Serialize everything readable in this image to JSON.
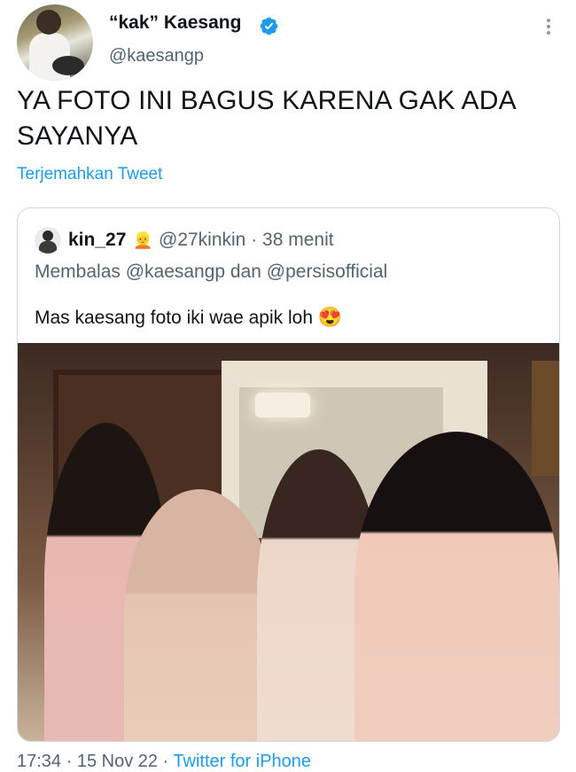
{
  "tweet": {
    "author_name": "“kak” Kaesang",
    "author_handle": "@kaesangp",
    "text": "YA FOTO INI BAGUS KARENA GAK ADA SAYANYA",
    "translate_label": "Terjemahkan Tweet",
    "timestamp": "17:34 · 15 Nov 22 · ",
    "source": "Twitter for iPhone"
  },
  "quoted": {
    "name": "kin_27",
    "name_emoji": "👱",
    "handle_time": "@27kinkin · 38 menit",
    "reply_to": "Membalas @kaesangp dan @persisofficial",
    "text": "Mas kaesang foto iki wae apik loh ",
    "text_emoji": "😍"
  },
  "colors": {
    "accent": "#1d9bf0",
    "secondary_text": "#536471",
    "border": "#cfd9de"
  },
  "icons": [
    "verified-badge-icon",
    "more-options-icon"
  ]
}
